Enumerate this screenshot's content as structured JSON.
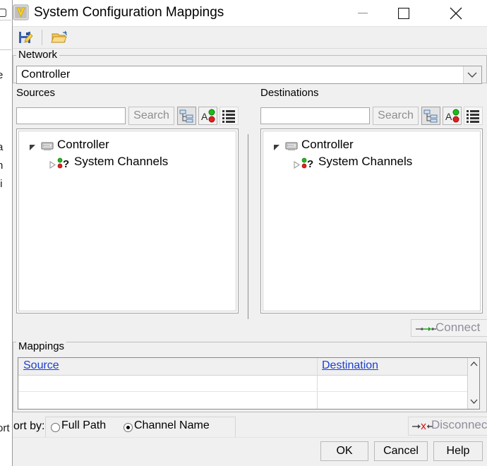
{
  "window": {
    "title": "System Configuration Mappings",
    "app_icon": "vector-v-logo-icon",
    "controls": {
      "minimize": "minimize-icon",
      "maximize": "maximize-icon",
      "close": "close-icon"
    }
  },
  "toolbar": {
    "save_label": "save-mapping-icon",
    "open_label": "open-mapping-icon"
  },
  "network": {
    "label": "Network",
    "selected": "Controller"
  },
  "sources": {
    "label": "Sources",
    "search": {
      "value": "",
      "placeholder": "",
      "button_label": "Search"
    },
    "view_buttons": [
      "tree-view-icon",
      "sort-alphabetic-icon",
      "flat-list-icon"
    ],
    "tree": [
      {
        "label": "Controller",
        "icon": "device-rack-icon",
        "expander": "expanded-arrow-icon",
        "children": [
          {
            "label": "System Channels",
            "icon": "channel-question-icon",
            "expander": "collapsed-arrow-icon"
          }
        ]
      }
    ]
  },
  "destinations": {
    "label": "Destinations",
    "search": {
      "value": "",
      "placeholder": "",
      "button_label": "Search"
    },
    "view_buttons": [
      "tree-view-icon",
      "sort-alphabetic-icon",
      "flat-list-icon"
    ],
    "tree": [
      {
        "label": "Controller",
        "icon": "device-rack-icon",
        "expander": "expanded-arrow-icon",
        "children": [
          {
            "label": "System Channels",
            "icon": "channel-question-icon",
            "expander": "collapsed-arrow-icon"
          }
        ]
      }
    ]
  },
  "connect": {
    "label": "Connect",
    "icon": "connect-arrow-icon",
    "enabled": false
  },
  "disconnect": {
    "label": "Disconnect",
    "icon": "disconnect-arrow-icon",
    "enabled": false
  },
  "mappings": {
    "label": "Mappings",
    "columns": [
      "Source",
      "Destination"
    ],
    "rows": [],
    "scrollbar": {
      "up": "scroll-up-icon",
      "down": "scroll-down-icon"
    }
  },
  "sort_by": {
    "label": "ort by:",
    "options": [
      {
        "label": "Full Path",
        "selected": false
      },
      {
        "label": "Channel Name",
        "selected": true
      }
    ]
  },
  "buttons": {
    "ok": "OK",
    "cancel": "Cancel",
    "help": "Help"
  },
  "background_window": {
    "fragments": [
      "e",
      "a",
      "n",
      "ti"
    ]
  },
  "colors": {
    "link": "#1b40d0",
    "dialog_bg": "#f0f0f0",
    "disabled_text": "#8f8f9b",
    "accent_green": "#12a012",
    "accent_red": "#d01414"
  }
}
